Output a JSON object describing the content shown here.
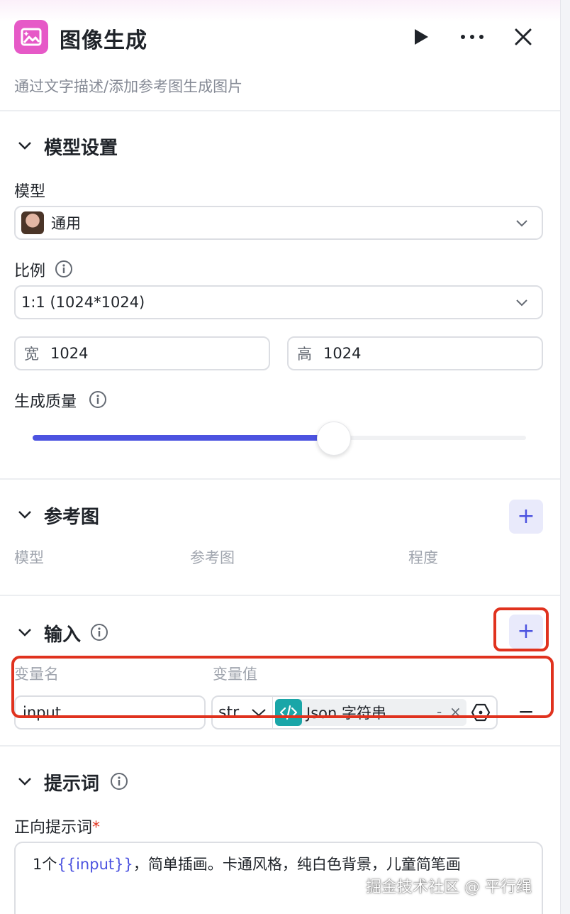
{
  "header": {
    "title": "图像生成",
    "description": "通过文字描述/添加参考图生成图片"
  },
  "model_settings": {
    "section_title": "模型设置",
    "model_label": "模型",
    "model_value": "通用",
    "ratio_label": "比例",
    "ratio_value": "1:1 (1024*1024)",
    "width_prefix": "宽",
    "width_value": "1024",
    "height_prefix": "高",
    "height_value": "1024",
    "quality_label": "生成质量",
    "quality_level": 0.61
  },
  "reference": {
    "section_title": "参考图",
    "add_label": "+",
    "columns": [
      "模型",
      "参考图",
      "程度"
    ]
  },
  "inputs": {
    "section_title": "输入",
    "add_label": "+",
    "col_name": "变量名",
    "col_value": "变量值",
    "rows": [
      {
        "name": "input",
        "type": "str.",
        "value_tag": "Json 字符串...",
        "tag_dash": "-",
        "tag_close": "×",
        "remove_label": "−"
      }
    ]
  },
  "prompt": {
    "section_title": "提示词",
    "positive_label": "正向提示词",
    "required_mark": "*",
    "text_prefix": "1个",
    "text_variable": "{{input}}",
    "text_suffix": "，简单插画。卡通风格，纯白色背景，儿童简笔画"
  },
  "watermark": "掘金技术社区 @ 平行绳",
  "colors": {
    "accent": "#4c53e0",
    "icon_bg": "#e659c7",
    "highlight_red": "#e0321e",
    "tag_teal": "#1aa6a8"
  }
}
